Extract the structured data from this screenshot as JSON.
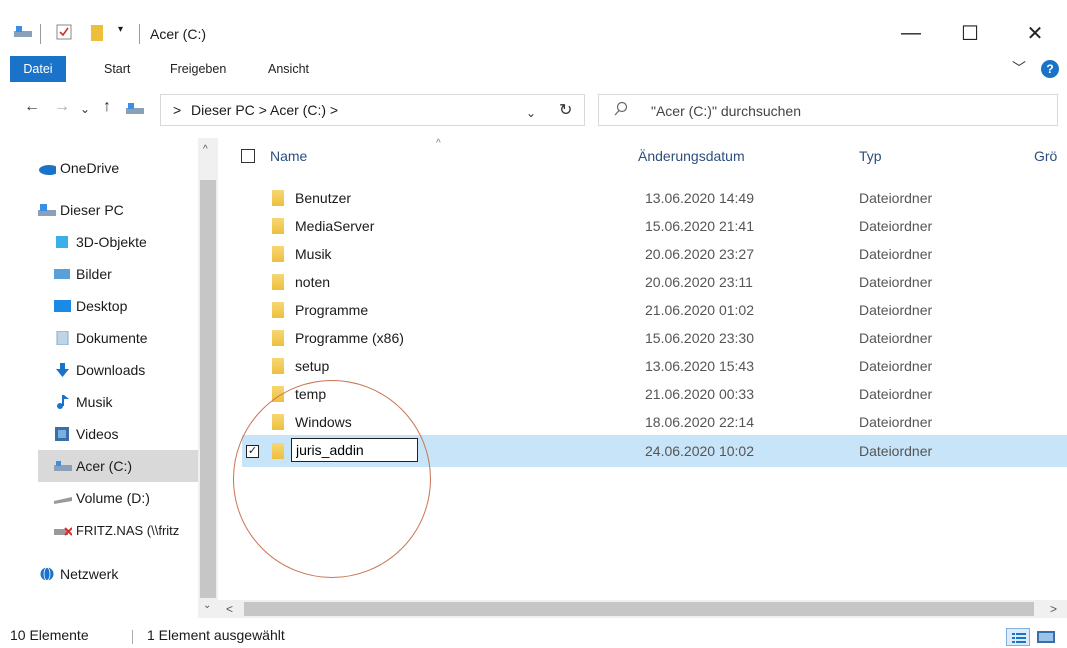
{
  "window": {
    "title": "Acer (C:)",
    "minimize_glyph": "—",
    "maximize_glyph": "☐",
    "close_glyph": "✕"
  },
  "ribbon": {
    "tabs": [
      "Datei",
      "Start",
      "Freigeben",
      "Ansicht"
    ],
    "chevron": "﹀",
    "help": "?"
  },
  "address": {
    "back": "←",
    "forward": "→",
    "recent": "⌄",
    "up": "↑",
    "path": [
      "Dieser PC",
      "Acer (C:)"
    ],
    "separator": ">",
    "dropdown": "⌄",
    "refresh": "↻",
    "search_placeholder": "\"Acer (C:)\" durchsuchen"
  },
  "navigation": {
    "items": [
      {
        "label": "OneDrive",
        "icon": "cloud-icon",
        "color": "#1a73c9"
      },
      {
        "label": "Dieser PC",
        "icon": "pc-icon",
        "color": "#3a8ee6"
      },
      {
        "label": "3D-Objekte",
        "icon": "cube-icon",
        "color": "#3ab0e8"
      },
      {
        "label": "Bilder",
        "icon": "pictures-icon",
        "color": "#5aa0d8"
      },
      {
        "label": "Desktop",
        "icon": "desktop-icon",
        "color": "#1a8ae6"
      },
      {
        "label": "Dokumente",
        "icon": "document-icon",
        "color": "#8aa8c8"
      },
      {
        "label": "Downloads",
        "icon": "download-icon",
        "color": "#1a73c9"
      },
      {
        "label": "Musik",
        "icon": "music-icon",
        "color": "#1a73c9"
      },
      {
        "label": "Videos",
        "icon": "video-icon",
        "color": "#3a6ea8"
      },
      {
        "label": "Acer (C:)",
        "icon": "drive-icon",
        "color": "#6a8ab0"
      },
      {
        "label": "Volume (D:)",
        "icon": "drive-icon",
        "color": "#9a9a9a"
      },
      {
        "label": "FRITZ.NAS (\\\\fritz",
        "icon": "network-drive-icon",
        "color": "#d03030"
      },
      {
        "label": "Netzwerk",
        "icon": "network-icon",
        "color": "#1a73c9"
      }
    ]
  },
  "columns": {
    "name": "Name",
    "date": "Änderungsdatum",
    "type": "Typ",
    "size": "Grö"
  },
  "files": [
    {
      "name": "Benutzer",
      "date": "13.06.2020 14:49",
      "type": "Dateiordner"
    },
    {
      "name": "MediaServer",
      "date": "15.06.2020 21:41",
      "type": "Dateiordner"
    },
    {
      "name": "Musik",
      "date": "20.06.2020 23:27",
      "type": "Dateiordner"
    },
    {
      "name": "noten",
      "date": "20.06.2020 23:11",
      "type": "Dateiordner"
    },
    {
      "name": "Programme",
      "date": "21.06.2020 01:02",
      "type": "Dateiordner"
    },
    {
      "name": "Programme (x86)",
      "date": "15.06.2020 23:30",
      "type": "Dateiordner"
    },
    {
      "name": "setup",
      "date": "13.06.2020 15:43",
      "type": "Dateiordner"
    },
    {
      "name": "temp",
      "date": "21.06.2020 00:33",
      "type": "Dateiordner"
    },
    {
      "name": "Windows",
      "date": "18.06.2020 22:14",
      "type": "Dateiordner"
    }
  ],
  "selected_file": {
    "name": "juris_addin",
    "date": "24.06.2020 10:02",
    "type": "Dateiordner",
    "check": "✓"
  },
  "status": {
    "count": "10 Elemente",
    "selected": "1 Element ausgewählt"
  },
  "scroll": {
    "up": "^",
    "down": "⌄",
    "left": "<",
    "right": ">"
  }
}
